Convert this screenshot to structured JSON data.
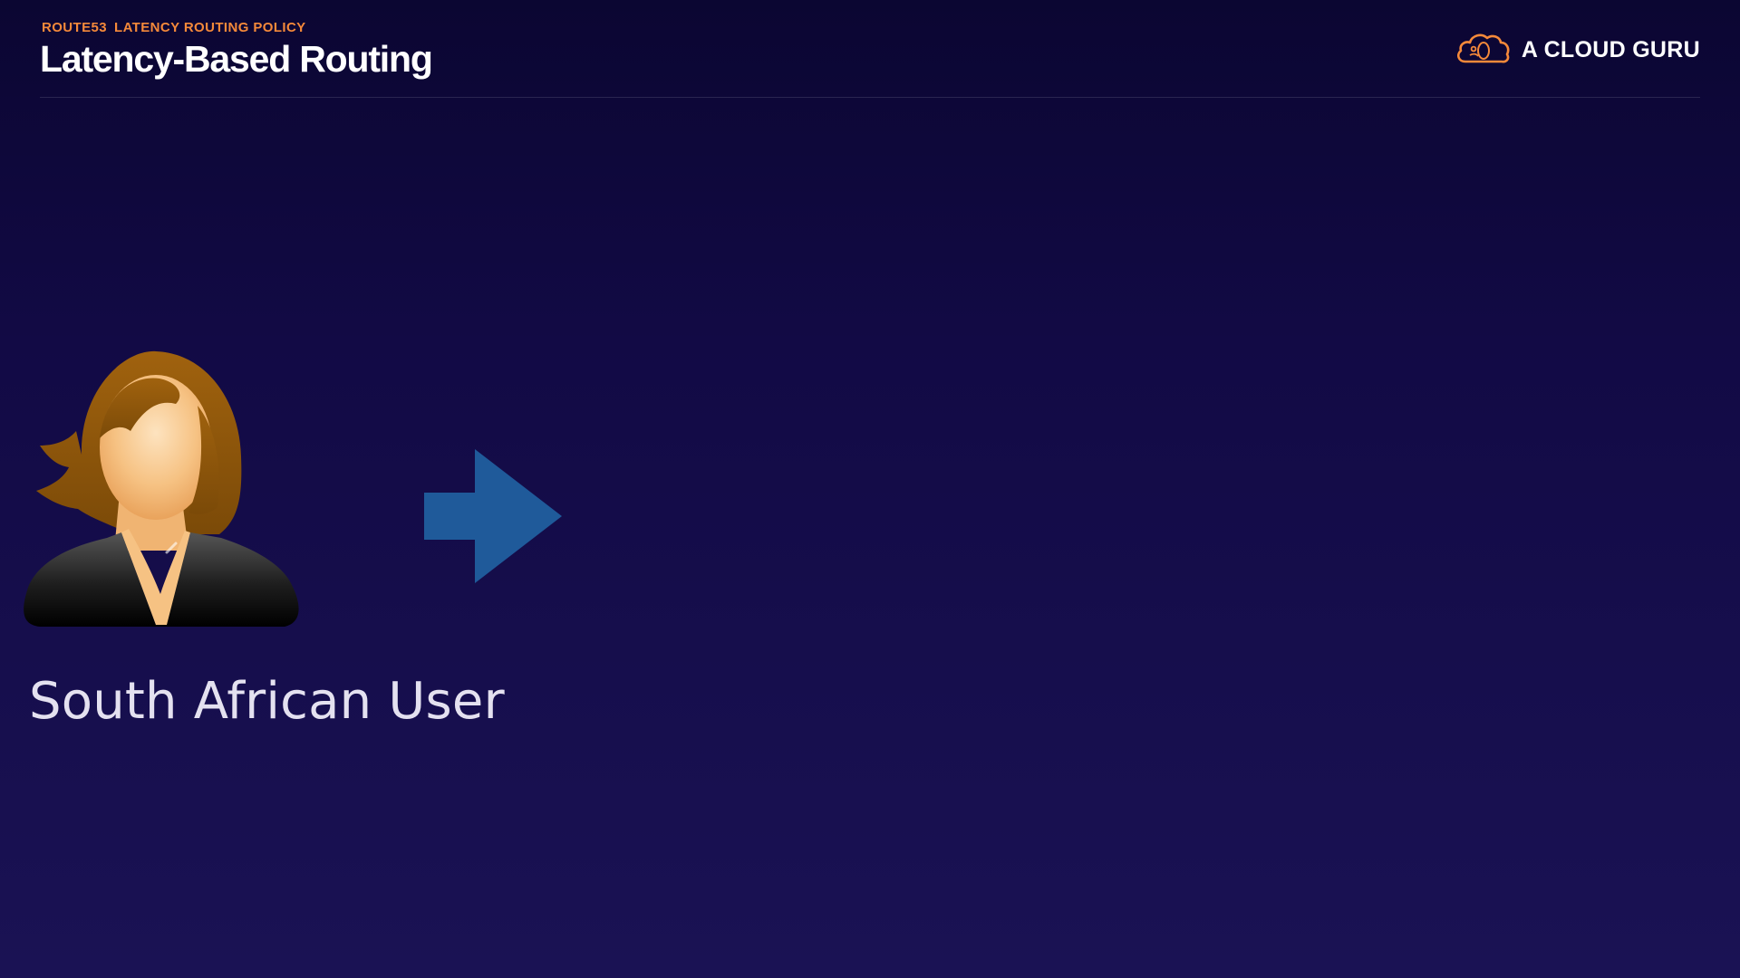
{
  "header": {
    "breadcrumb": [
      "ROUTE53",
      "LATENCY ROUTING POLICY"
    ],
    "title": "Latency-Based Routing"
  },
  "brand": {
    "logo_icon": "cloud-logo-icon",
    "name": "A CLOUD GURU",
    "accent_color": "#f5893a"
  },
  "main": {
    "user_icon": "female-user-avatar-icon",
    "arrow_icon": "arrow-right-icon",
    "arrow_color": "#1f5a9a",
    "user_label": "South African User"
  }
}
